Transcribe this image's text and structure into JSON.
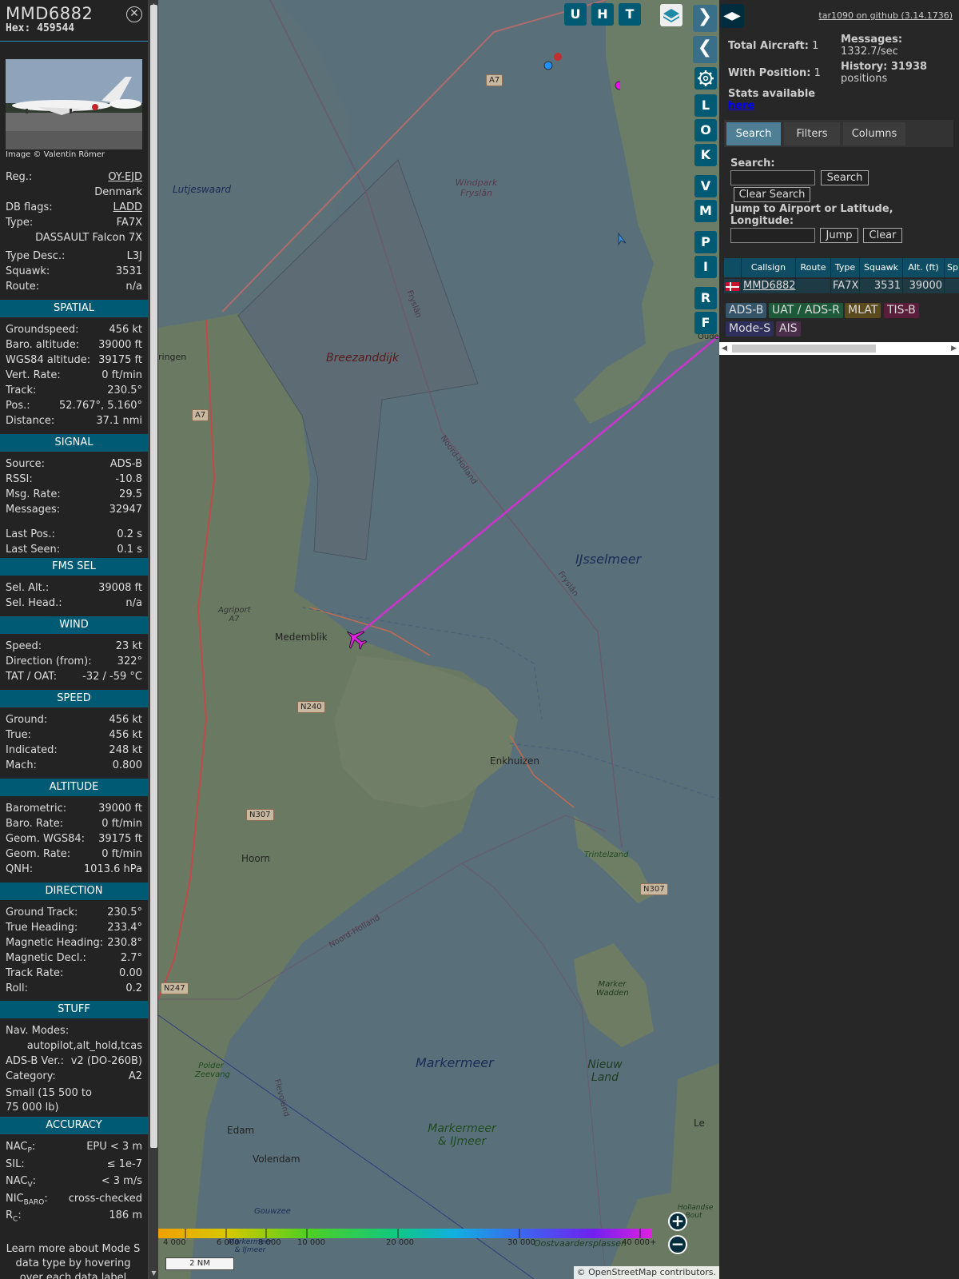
{
  "selected": {
    "callsign": "MMD6882",
    "hex": "Hex: 459544",
    "photo_credit": "Image © Valentin Römer",
    "info": [
      {
        "k": "Reg.:",
        "v": "OY-EJD"
      },
      {
        "k": "",
        "v": "Denmark"
      },
      {
        "k": "DB flags:",
        "v": "LADD"
      },
      {
        "k": "Type:",
        "v": "FA7X"
      },
      {
        "k": "",
        "v": "DASSAULT Falcon 7X"
      },
      {
        "k": "Type Desc.:",
        "v": "L3J"
      },
      {
        "k": "Squawk:",
        "v": "3531"
      },
      {
        "k": "Route:",
        "v": "n/a"
      }
    ],
    "spatial_title": "SPATIAL",
    "spatial": [
      {
        "k": "Groundspeed:",
        "v": "456 kt"
      },
      {
        "k": "Baro. altitude:",
        "v": "39000 ft"
      },
      {
        "k": "WGS84 altitude:",
        "v": "39175 ft"
      },
      {
        "k": "Vert. Rate:",
        "v": "0 ft/min"
      },
      {
        "k": "Track:",
        "v": "230.5°"
      },
      {
        "k": "Pos.:",
        "v": "52.767°, 5.160°"
      },
      {
        "k": "Distance:",
        "v": "37.1 nmi"
      }
    ],
    "signal_title": "SIGNAL",
    "signal": [
      {
        "k": "Source:",
        "v": "ADS-B"
      },
      {
        "k": "RSSI:",
        "v": "-10.8"
      },
      {
        "k": "Msg. Rate:",
        "v": "29.5"
      },
      {
        "k": "Messages:",
        "v": "32947"
      },
      {
        "k": "Last Pos.:",
        "v": "0.2 s"
      },
      {
        "k": "Last Seen:",
        "v": "0.1 s"
      }
    ],
    "fms_title": "FMS SEL",
    "fms": [
      {
        "k": "Sel. Alt.:",
        "v": "39008 ft"
      },
      {
        "k": "Sel. Head.:",
        "v": "n/a"
      }
    ],
    "wind_title": "WIND",
    "wind": [
      {
        "k": "Speed:",
        "v": "23 kt"
      },
      {
        "k": "Direction (from):",
        "v": "322°"
      },
      {
        "k": "TAT / OAT:",
        "v": "-32 / -59 °C"
      }
    ],
    "speed_title": "SPEED",
    "speed": [
      {
        "k": "Ground:",
        "v": "456 kt"
      },
      {
        "k": "True:",
        "v": "456 kt"
      },
      {
        "k": "Indicated:",
        "v": "248 kt"
      },
      {
        "k": "Mach:",
        "v": "0.800"
      }
    ],
    "altitude_title": "ALTITUDE",
    "altitude": [
      {
        "k": "Barometric:",
        "v": "39000 ft"
      },
      {
        "k": "Baro. Rate:",
        "v": "0 ft/min"
      },
      {
        "k": "Geom. WGS84:",
        "v": "39175 ft"
      },
      {
        "k": "Geom. Rate:",
        "v": "0 ft/min"
      },
      {
        "k": "QNH:",
        "v": "1013.6 hPa"
      }
    ],
    "direction_title": "DIRECTION",
    "direction": [
      {
        "k": "Ground Track:",
        "v": "230.5°"
      },
      {
        "k": "True Heading:",
        "v": "233.4°"
      },
      {
        "k": "Magnetic Heading:",
        "v": "230.8°"
      },
      {
        "k": "Magnetic Decl.:",
        "v": "2.7°"
      },
      {
        "k": "Track Rate:",
        "v": "0.00"
      },
      {
        "k": "Roll:",
        "v": "0.2"
      }
    ],
    "stuff_title": "STUFF",
    "nav_modes_label": "Nav. Modes:",
    "nav_modes_value": "autopilot,alt_hold,tcas",
    "adsb_ver_label": "ADS-B Ver.:",
    "adsb_ver_value": "v2 (DO-260B)",
    "category_label": "Category:",
    "category_value": "A2",
    "category_desc": "Small (15 500 to 75 000 lb)",
    "accuracy_title": "ACCURACY",
    "accuracy": [
      {
        "k": "NAC",
        "sub": "P",
        "v": "EPU < 3 m"
      },
      {
        "k": "SIL:",
        "sub": "",
        "v": "≤ 1e-7"
      },
      {
        "k": "NAC",
        "sub": "V",
        "v": "< 3 m/s"
      },
      {
        "k": "NIC",
        "sub": "BARO",
        "v": "cross-checked"
      },
      {
        "k": "R",
        "sub": "C",
        "v": "186 m"
      }
    ],
    "footer": "Learn more about Mode S data type by hovering over each data label"
  },
  "map": {
    "toolbar_top": [
      "U",
      "H",
      "T"
    ],
    "toolbar_side": [
      "L",
      "O",
      "K",
      "V",
      "M",
      "P",
      "I",
      "R",
      "F"
    ],
    "labels": {
      "lutjeswaard": "Lutjeswaard",
      "windpark": "Windpark Fryslân",
      "breezanddijk": "Breezanddijk",
      "ringen": "ringen",
      "fryslan1": "Fryslân",
      "noordholland1": "Noord-Holland",
      "ijsselmeer": "IJsselmeer",
      "fryslan2": "Fryslân",
      "agriport": "Agriport A7",
      "medemblik": "Medemblik",
      "enkhuizen": "Enkhuizen",
      "hoorn": "Hoorn",
      "trintelzand": "Trintelzand",
      "noordholland2": "Noord-Holland",
      "markerwadden": "Marker Wadden",
      "markermeer": "Markermeer",
      "nieuwland": "Nieuw Land",
      "polderzeevang": "Polder Zeevang",
      "flevoland": "Flevoland",
      "edam": "Edam",
      "volendam": "Volendam",
      "markermeerijmeer": "Markermeer & IJmeer",
      "hollandse": "Hollandse Bout",
      "oostvaarders": "Oostvaardersplassen",
      "markermeer_ij2": "Markermeer & IJmeer",
      "gouwzee": "Gouwzee",
      "le": "Le",
      "oude": "Oude"
    },
    "roads": [
      "A7",
      "A7",
      "N240",
      "N307",
      "N307",
      "N247"
    ],
    "scale_ticks": [
      "4 000",
      "6 000",
      "8 000",
      "10 000",
      "20 000",
      "30 000",
      "40 000+"
    ],
    "scale_nm": "2 NM",
    "attribution": "© OpenStreetMap contributors."
  },
  "sidebar": {
    "github_link": "tar1090 on github (3.14.1736)",
    "total_aircraft_label": "Total Aircraft:",
    "total_aircraft": "1",
    "with_position_label": "With Position:",
    "with_position": "1",
    "stats_label": "Stats available",
    "stats_link": "here",
    "messages_label": "Messages:",
    "messages_rate": "1332.7/sec",
    "history_label": "History: 31938",
    "history_unit": "positions",
    "tabs": [
      "Search",
      "Filters",
      "Columns"
    ],
    "search_label": "Search:",
    "search_button": "Search",
    "clear_search_button": "Clear Search",
    "jump_label": "Jump to Airport or Latitude, Longitude:",
    "jump_button": "Jump",
    "clear_button": "Clear",
    "table_headers": [
      "Callsign",
      "Route",
      "Type",
      "Squawk",
      "Alt. (ft)",
      "Sp"
    ],
    "table_row": {
      "callsign": "MMD6882",
      "route": "",
      "type": "FA7X",
      "squawk": "3531",
      "alt": "39000"
    },
    "source_chips": [
      "ADS-B",
      "UAT / ADS-R",
      "MLAT",
      "TIS-B",
      "Mode-S",
      "AIS"
    ]
  }
}
